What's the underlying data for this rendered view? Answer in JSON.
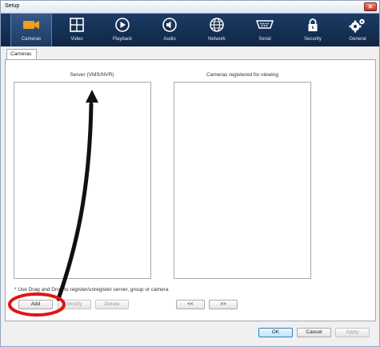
{
  "window": {
    "title": "Setup",
    "close_glyph": "✕"
  },
  "toolbar": {
    "items": [
      {
        "label": "Cameras",
        "icon": "camera-icon",
        "selected": true
      },
      {
        "label": "Video",
        "icon": "video-grid-icon",
        "selected": false
      },
      {
        "label": "Playback",
        "icon": "playback-icon",
        "selected": false
      },
      {
        "label": "Audio",
        "icon": "audio-icon",
        "selected": false
      },
      {
        "label": "Network",
        "icon": "network-globe-icon",
        "selected": false
      },
      {
        "label": "Serial",
        "icon": "serial-port-icon",
        "selected": false
      },
      {
        "label": "Security",
        "icon": "padlock-icon",
        "selected": false
      },
      {
        "label": "General",
        "icon": "gears-icon",
        "selected": false
      }
    ]
  },
  "tabs": {
    "active": "Cameras"
  },
  "server_list": {
    "title": "Server (VMS/NVR)"
  },
  "registered_list": {
    "title": "Cameras registered for viewing"
  },
  "note": "* Use Drag and Drop to register/unregister server, group or camera",
  "actions": {
    "add": "Add",
    "modify": "Modify",
    "delete": "Delete",
    "move_left": "<<",
    "move_right": ">>"
  },
  "dialog_buttons": {
    "ok": "OK",
    "cancel": "Cancel",
    "apply": "Apply"
  },
  "colors": {
    "toolbar_bg": "#132f52",
    "camera_icon": "#f0a01e",
    "annotation_red": "#e01515",
    "annotation_arrow": "#111111"
  }
}
